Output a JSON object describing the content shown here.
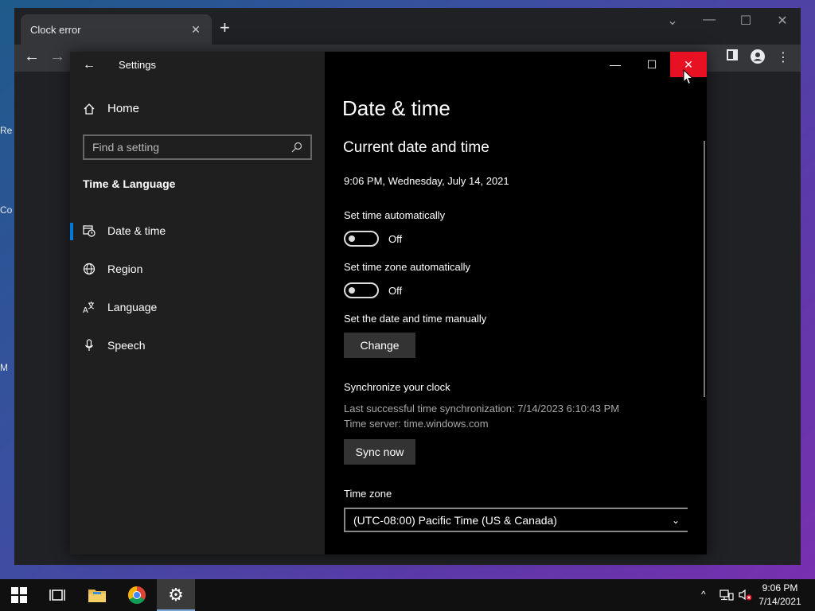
{
  "browser": {
    "tab_title": "Clock error",
    "tab_close": "✕",
    "new_tab": "+"
  },
  "settings": {
    "app_title": "Settings",
    "home_label": "Home",
    "search_placeholder": "Find a setting",
    "section_title": "Time & Language",
    "nav_items": [
      {
        "label": "Date & time",
        "icon": "clock-calendar-icon",
        "selected": true
      },
      {
        "label": "Region",
        "icon": "globe-icon",
        "selected": false
      },
      {
        "label": "Language",
        "icon": "language-icon",
        "selected": false
      },
      {
        "label": "Speech",
        "icon": "microphone-icon",
        "selected": false
      }
    ],
    "page_title": "Date & time",
    "current_heading": "Current date and time",
    "current_datetime": "9:06 PM, Wednesday, July 14, 2021",
    "set_time_auto": {
      "label": "Set time automatically",
      "state": "Off"
    },
    "set_tz_auto": {
      "label": "Set time zone automatically",
      "state": "Off"
    },
    "manual": {
      "label": "Set the date and time manually",
      "button": "Change"
    },
    "sync": {
      "heading": "Synchronize your clock",
      "last_sync": "Last successful time synchronization: 7/14/2023 6:10:43 PM",
      "server": "Time server: time.windows.com",
      "button": "Sync now"
    },
    "timezone": {
      "label": "Time zone",
      "value": "(UTC-08:00) Pacific Time (US & Canada)"
    }
  },
  "taskbar": {
    "time": "9:06 PM",
    "date": "7/14/2021"
  },
  "desktop_fragments": [
    "Re",
    "Co",
    "M"
  ],
  "colors": {
    "accent": "#0078d7",
    "close_red": "#e81123"
  }
}
